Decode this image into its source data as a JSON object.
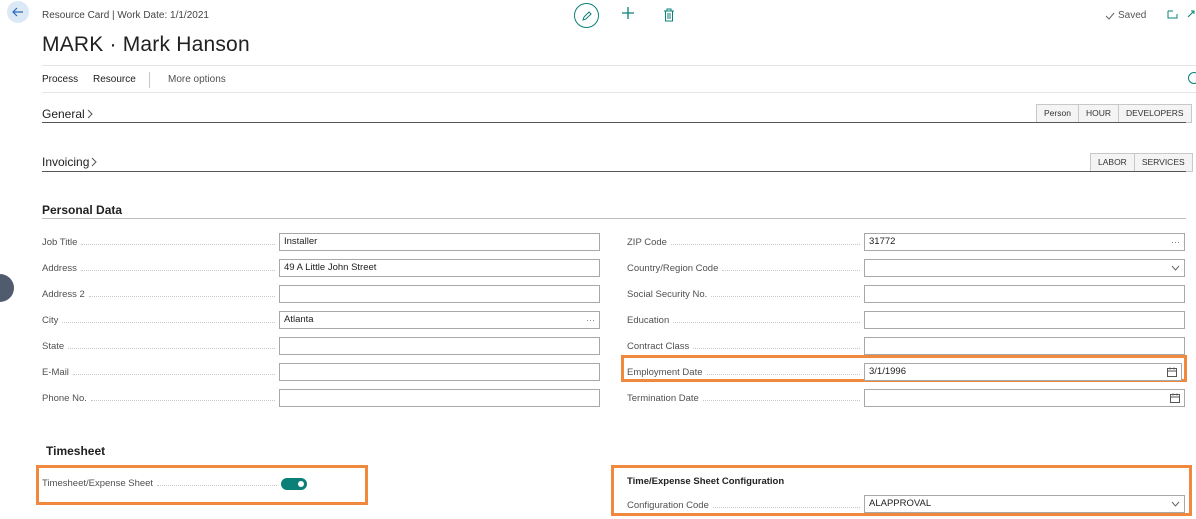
{
  "header": {
    "breadcrumb": "Resource Card | Work Date: 1/1/2021",
    "title": "MARK · Mark Hanson",
    "saved_label": "Saved"
  },
  "actions": {
    "process": "Process",
    "resource": "Resource",
    "more_options": "More options"
  },
  "general": {
    "title": "General",
    "chips": [
      "Person",
      "HOUR",
      "DEVELOPERS"
    ]
  },
  "invoicing": {
    "title": "Invoicing",
    "chips": [
      "LABOR",
      "SERVICES"
    ]
  },
  "personal_data": {
    "title": "Personal Data",
    "left_fields": [
      {
        "label": "Job Title",
        "value": ""
      },
      {
        "label": "Address",
        "value": "49 A Little John Street"
      },
      {
        "label": "Address 2",
        "value": ""
      },
      {
        "label": "City",
        "value": "Atlanta"
      },
      {
        "label": "State",
        "value": ""
      },
      {
        "label": "E-Mail",
        "value": ""
      },
      {
        "label": "Phone No.",
        "value": ""
      }
    ],
    "right_fields": [
      {
        "label": "ZIP Code",
        "value": "31772"
      },
      {
        "label": "Country/Region Code",
        "value": ""
      },
      {
        "label": "Social Security No.",
        "value": ""
      },
      {
        "label": "Education",
        "value": ""
      },
      {
        "label": "Contract Class",
        "value": ""
      },
      {
        "label": "Employment Date",
        "value": "3/1/1996"
      },
      {
        "label": "Termination Date",
        "value": ""
      }
    ],
    "job_title_value": "Installer",
    "more_glyph": "···",
    "chevron_glyph": "⌵"
  },
  "timesheet": {
    "title": "Timesheet",
    "toggle_label": "Timesheet/Expense Sheet",
    "toggle_on": true,
    "config_title": "Time/Expense Sheet Configuration",
    "config_label": "Configuration Code",
    "config_value": "ALAPPROVAL"
  },
  "colors": {
    "accent": "#0a8078",
    "highlight": "#f0883e"
  }
}
